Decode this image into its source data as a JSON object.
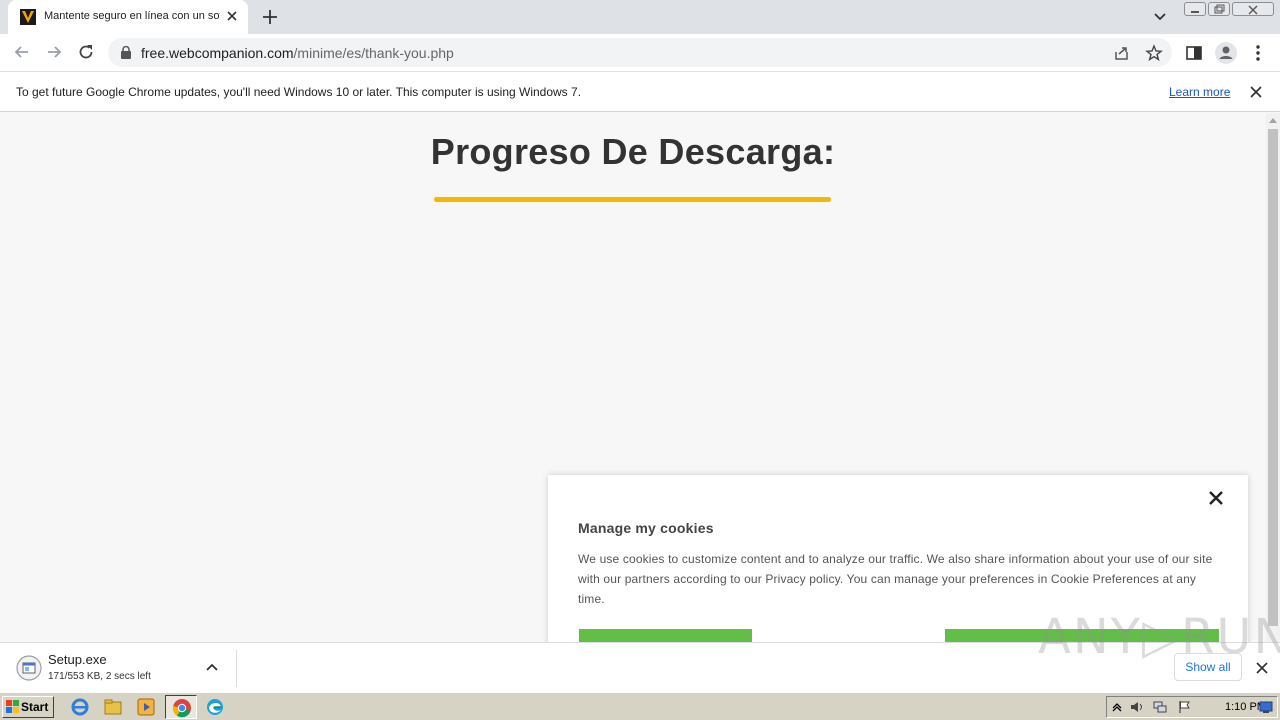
{
  "browser": {
    "tab": {
      "title": "Mantente seguro en línea con un software",
      "close_icon": "close-icon",
      "favicon": "webcompanion-favicon"
    },
    "new_tab_icon": "plus-icon",
    "url": {
      "host": "free.webcompanion.com",
      "path": "/minime/es/thank-you.php"
    },
    "info_bar": {
      "message": "To get future Google Chrome updates, you'll need Windows 10 or later. This computer is using Windows 7.",
      "link": "Learn more"
    }
  },
  "page": {
    "heading": "Progreso De Descarga:",
    "progress_percent": 100,
    "progress_color": "#f5b800"
  },
  "cookie_panel": {
    "title": "Manage my cookies",
    "body": "We use cookies to customize content and to analyze our traffic. We also share information about your use of our site with our partners according to our Privacy policy. You can manage your preferences in Cookie Preferences at any time.",
    "button_color": "#62be46"
  },
  "download_bar": {
    "file_name": "Setup.exe",
    "status": "171/553 KB, 2 secs left",
    "show_all": "Show all",
    "watermark": "ANY▷RUN"
  },
  "taskbar": {
    "start_label": "Start",
    "clock": "1:10 PM"
  }
}
